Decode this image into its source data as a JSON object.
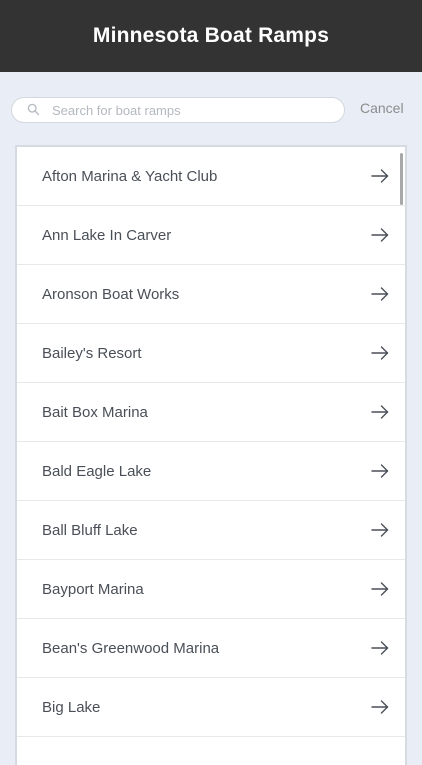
{
  "header": {
    "title": "Minnesota Boat Ramps"
  },
  "search": {
    "placeholder": "Search for boat ramps",
    "value": "",
    "cancel_label": "Cancel"
  },
  "list": {
    "items": [
      {
        "label": "Afton Marina & Yacht Club"
      },
      {
        "label": "Ann Lake In Carver"
      },
      {
        "label": "Aronson Boat Works"
      },
      {
        "label": "Bailey's Resort"
      },
      {
        "label": "Bait Box Marina"
      },
      {
        "label": "Bald Eagle Lake"
      },
      {
        "label": "Ball Bluff Lake"
      },
      {
        "label": "Bayport Marina"
      },
      {
        "label": "Bean's Greenwood Marina"
      },
      {
        "label": "Big Lake"
      },
      {
        "label": ""
      }
    ]
  },
  "colors": {
    "header_bg": "#333333",
    "page_bg": "#e9eef6",
    "text": "#4a4f57"
  }
}
